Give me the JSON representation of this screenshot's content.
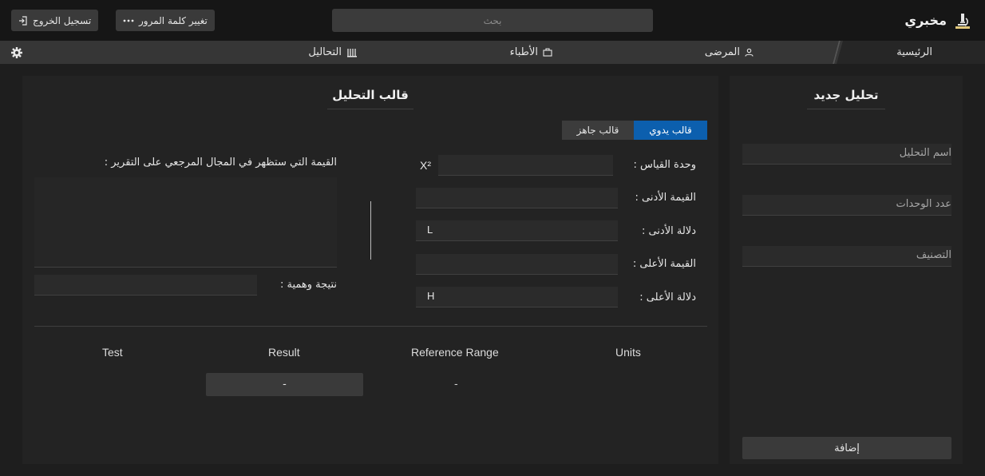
{
  "header": {
    "brand": "مخبري",
    "search_placeholder": "بحث",
    "change_password": "تغيير كلمة المرور",
    "logout": "تسجيل الخروج"
  },
  "nav": {
    "home": "الرئيسية",
    "patients": "المرضى",
    "doctors": "الأطباء",
    "analyses": "التحاليل"
  },
  "new_analysis": {
    "title": "تحليل جديد",
    "name_placeholder": "اسم التحليل",
    "units_placeholder": "عدد الوحدات",
    "category_placeholder": "التصنيف",
    "add_button": "إضافة"
  },
  "template": {
    "title": "قالب التحليل",
    "tab_manual": "قالب يدوي",
    "tab_ready": "قالب جاهز",
    "unit_label": "وحدة القياس :",
    "unit_symbol": "X²",
    "min_label": "القيمة الأدنى :",
    "min_flag_label": "دلالة الأدنى :",
    "min_flag_value": "L",
    "max_label": "القيمة الأعلى :",
    "max_flag_label": "دلالة الأعلى :",
    "max_flag_value": "H",
    "ref_text_label": "القيمة التي ستظهر في المجال المرجعي على التقرير :",
    "dummy_label": "نتيجة وهمية :"
  },
  "preview": {
    "headers": [
      "Test",
      "Result",
      "Reference Range",
      "Units"
    ],
    "result": "-",
    "reference_range": "-"
  },
  "colors": {
    "accent": "#0c5fae",
    "background": "#1e1e1e",
    "panel": "#232323"
  }
}
